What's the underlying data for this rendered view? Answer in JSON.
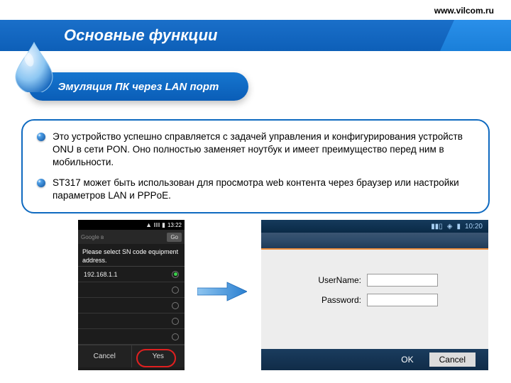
{
  "header": {
    "url": "www.vilcom.ru",
    "title": "Основные функции",
    "subtitle": "Эмуляция ПК через LAN порт"
  },
  "bullets": [
    "Это устройство успешно справляется с задачей управления и конфигурирования устройств ONU  в сети PON. Оно полностью заменяет ноутбук и имеет преимущество  перед ним в мобильности.",
    "ST317 может быть использован для просмотра web контента через браузер или настройки параметров LAN и PPPoE."
  ],
  "phone": {
    "time": "13:22",
    "search_hint": "Google в",
    "go_label": "Go",
    "popup_title": "Please select SN code equipment address.",
    "ip": "192.168.1.1",
    "cancel": "Cancel",
    "yes": "Yes"
  },
  "tablet": {
    "time": "10:20",
    "username_label": "UserName:",
    "password_label": "Password:",
    "ok": "OK",
    "cancel": "Cancel"
  }
}
